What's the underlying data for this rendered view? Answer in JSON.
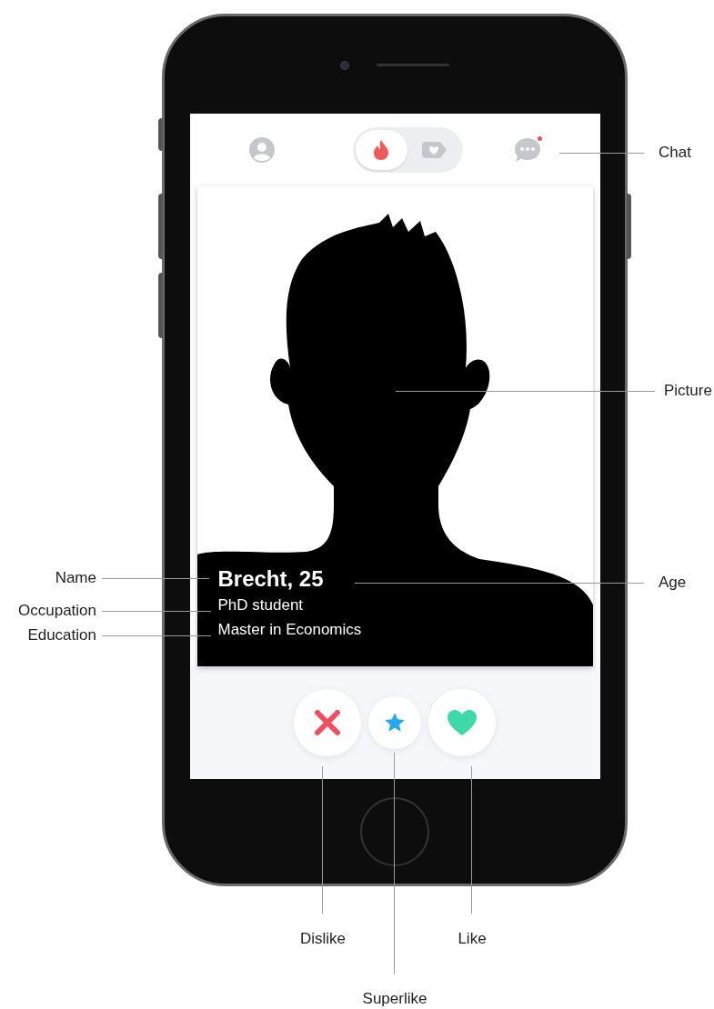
{
  "app": {
    "top_bar": {
      "tabs": [
        {
          "kind": "flame",
          "selected": true
        },
        {
          "kind": "likes",
          "selected": false
        }
      ],
      "chat_unread": true
    },
    "profile": {
      "name_age": "Brecht, 25",
      "occupation": "PhD student",
      "education": "Master in Economics"
    },
    "actions": [
      {
        "kind": "dislike"
      },
      {
        "kind": "superlike"
      },
      {
        "kind": "like"
      }
    ]
  },
  "annotations": [
    {
      "label": "Chat"
    },
    {
      "label": "Picture"
    },
    {
      "label": "Age"
    },
    {
      "label": "Name"
    },
    {
      "label": "Occupation"
    },
    {
      "label": "Education"
    },
    {
      "label": "Dislike"
    },
    {
      "label": "Superlike"
    },
    {
      "label": "Like"
    }
  ]
}
